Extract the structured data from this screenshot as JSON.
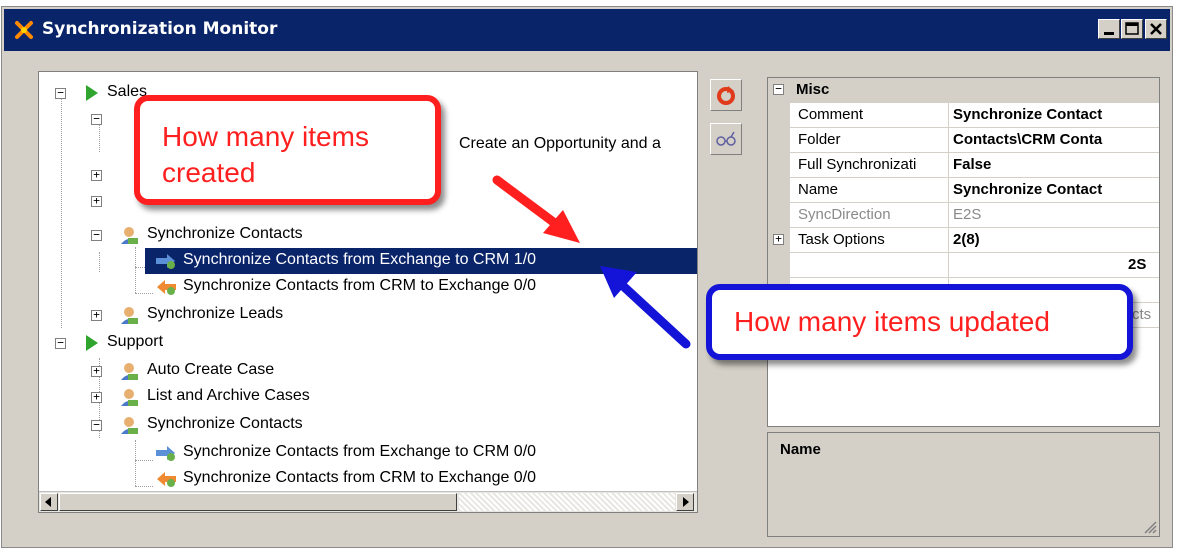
{
  "window": {
    "title": "Synchronization Monitor"
  },
  "tree": {
    "nodes": [
      {
        "label": "Sales"
      },
      {
        "label": "Create an Opportunity and a"
      },
      {
        "label": "Synchronize Contacts"
      },
      {
        "label": "Synchronize Contacts from Exchange to CRM 1/0"
      },
      {
        "label": "Synchronize Contacts from CRM to Exchange 0/0"
      },
      {
        "label": "Synchronize Leads"
      },
      {
        "label": "Support"
      },
      {
        "label": "Auto Create Case"
      },
      {
        "label": "List and Archive Cases"
      },
      {
        "label": "Synchronize Contacts"
      },
      {
        "label": "Synchronize Contacts from Exchange to CRM 0/0"
      },
      {
        "label": "Synchronize Contacts from CRM to Exchange 0/0"
      }
    ]
  },
  "properties": {
    "category": "Misc",
    "rows": [
      {
        "name": "Comment",
        "value": "Synchronize Contact"
      },
      {
        "name": "Folder",
        "value": "Contacts\\CRM Conta"
      },
      {
        "name": "Full Synchronizati",
        "value": "False"
      },
      {
        "name": "Name",
        "value": "Synchronize Contact"
      },
      {
        "name": "SyncDirection",
        "value": "E2S"
      },
      {
        "name": "Task Options",
        "value": "2(8)"
      }
    ],
    "partial_values": [
      "2S",
      "cts"
    ],
    "description_title": "Name"
  },
  "annotations": {
    "created_callout": "How many items created",
    "updated_callout": "How many items updated"
  },
  "colors": {
    "selection": "#0a246a",
    "callout_red": "#ff1f1f",
    "callout_blue": "#1414d8",
    "arrow_red": "#ff1f1f",
    "arrow_blue": "#1414d8"
  }
}
